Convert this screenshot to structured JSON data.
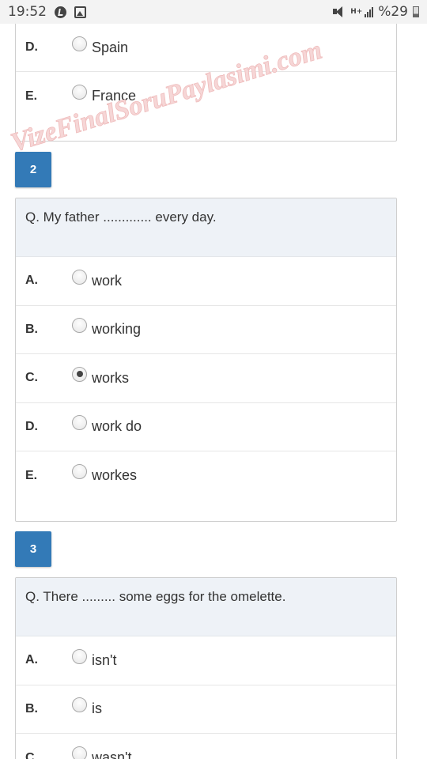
{
  "status_bar": {
    "time": "19:52",
    "network": "H+",
    "battery": "%29",
    "icons": [
      "music-icon",
      "image-icon",
      "mute-icon",
      "signal-icon",
      "battery-icon"
    ]
  },
  "watermark": {
    "text": "VizeFinalSoruPaylasimi.com",
    "color": "#f2c9c9"
  },
  "colors": {
    "accent": "#337ab7",
    "question_bg": "#eef2f7",
    "border": "#cfcfcf"
  },
  "previous_options": [
    {
      "letter": "D.",
      "text": "Spain",
      "checked": false
    },
    {
      "letter": "E.",
      "text": "France",
      "checked": false
    }
  ],
  "questions": [
    {
      "number": "2",
      "text": "Q. My father ............. every day.",
      "options": [
        {
          "letter": "A.",
          "text": "work",
          "checked": false
        },
        {
          "letter": "B.",
          "text": "working",
          "checked": false
        },
        {
          "letter": "C.",
          "text": "works",
          "checked": true
        },
        {
          "letter": "D.",
          "text": "work do",
          "checked": false
        },
        {
          "letter": "E.",
          "text": "workes",
          "checked": false
        }
      ]
    },
    {
      "number": "3",
      "text": "Q. There ......... some eggs for the omelette.",
      "options": [
        {
          "letter": "A.",
          "text": "isn't",
          "checked": false
        },
        {
          "letter": "B.",
          "text": "is",
          "checked": false
        },
        {
          "letter": "C.",
          "text": "wasn't",
          "checked": false
        }
      ]
    }
  ]
}
